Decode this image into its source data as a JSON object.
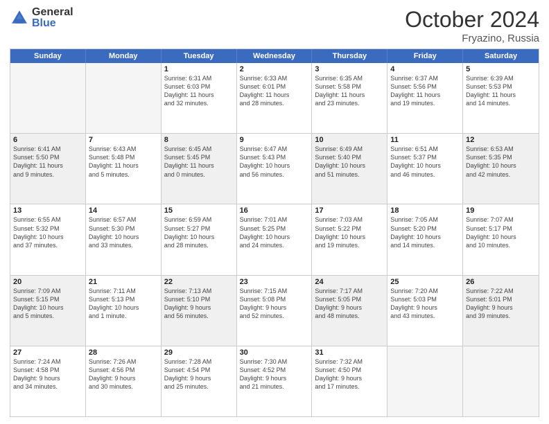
{
  "logo": {
    "general": "General",
    "blue": "Blue"
  },
  "title": {
    "month": "October 2024",
    "location": "Fryazino, Russia"
  },
  "header": {
    "days": [
      "Sunday",
      "Monday",
      "Tuesday",
      "Wednesday",
      "Thursday",
      "Friday",
      "Saturday"
    ]
  },
  "rows": [
    [
      {
        "day": "",
        "info": "",
        "empty": true
      },
      {
        "day": "",
        "info": "",
        "empty": true
      },
      {
        "day": "1",
        "info": "Sunrise: 6:31 AM\nSunset: 6:03 PM\nDaylight: 11 hours\nand 32 minutes."
      },
      {
        "day": "2",
        "info": "Sunrise: 6:33 AM\nSunset: 6:01 PM\nDaylight: 11 hours\nand 28 minutes."
      },
      {
        "day": "3",
        "info": "Sunrise: 6:35 AM\nSunset: 5:58 PM\nDaylight: 11 hours\nand 23 minutes."
      },
      {
        "day": "4",
        "info": "Sunrise: 6:37 AM\nSunset: 5:56 PM\nDaylight: 11 hours\nand 19 minutes."
      },
      {
        "day": "5",
        "info": "Sunrise: 6:39 AM\nSunset: 5:53 PM\nDaylight: 11 hours\nand 14 minutes."
      }
    ],
    [
      {
        "day": "6",
        "info": "Sunrise: 6:41 AM\nSunset: 5:50 PM\nDaylight: 11 hours\nand 9 minutes.",
        "shaded": true
      },
      {
        "day": "7",
        "info": "Sunrise: 6:43 AM\nSunset: 5:48 PM\nDaylight: 11 hours\nand 5 minutes."
      },
      {
        "day": "8",
        "info": "Sunrise: 6:45 AM\nSunset: 5:45 PM\nDaylight: 11 hours\nand 0 minutes.",
        "shaded": true
      },
      {
        "day": "9",
        "info": "Sunrise: 6:47 AM\nSunset: 5:43 PM\nDaylight: 10 hours\nand 56 minutes."
      },
      {
        "day": "10",
        "info": "Sunrise: 6:49 AM\nSunset: 5:40 PM\nDaylight: 10 hours\nand 51 minutes.",
        "shaded": true
      },
      {
        "day": "11",
        "info": "Sunrise: 6:51 AM\nSunset: 5:37 PM\nDaylight: 10 hours\nand 46 minutes."
      },
      {
        "day": "12",
        "info": "Sunrise: 6:53 AM\nSunset: 5:35 PM\nDaylight: 10 hours\nand 42 minutes.",
        "shaded": true
      }
    ],
    [
      {
        "day": "13",
        "info": "Sunrise: 6:55 AM\nSunset: 5:32 PM\nDaylight: 10 hours\nand 37 minutes."
      },
      {
        "day": "14",
        "info": "Sunrise: 6:57 AM\nSunset: 5:30 PM\nDaylight: 10 hours\nand 33 minutes.",
        "shaded": false
      },
      {
        "day": "15",
        "info": "Sunrise: 6:59 AM\nSunset: 5:27 PM\nDaylight: 10 hours\nand 28 minutes."
      },
      {
        "day": "16",
        "info": "Sunrise: 7:01 AM\nSunset: 5:25 PM\nDaylight: 10 hours\nand 24 minutes.",
        "shaded": false
      },
      {
        "day": "17",
        "info": "Sunrise: 7:03 AM\nSunset: 5:22 PM\nDaylight: 10 hours\nand 19 minutes."
      },
      {
        "day": "18",
        "info": "Sunrise: 7:05 AM\nSunset: 5:20 PM\nDaylight: 10 hours\nand 14 minutes.",
        "shaded": false
      },
      {
        "day": "19",
        "info": "Sunrise: 7:07 AM\nSunset: 5:17 PM\nDaylight: 10 hours\nand 10 minutes."
      }
    ],
    [
      {
        "day": "20",
        "info": "Sunrise: 7:09 AM\nSunset: 5:15 PM\nDaylight: 10 hours\nand 5 minutes.",
        "shaded": true
      },
      {
        "day": "21",
        "info": "Sunrise: 7:11 AM\nSunset: 5:13 PM\nDaylight: 10 hours\nand 1 minute."
      },
      {
        "day": "22",
        "info": "Sunrise: 7:13 AM\nSunset: 5:10 PM\nDaylight: 9 hours\nand 56 minutes.",
        "shaded": true
      },
      {
        "day": "23",
        "info": "Sunrise: 7:15 AM\nSunset: 5:08 PM\nDaylight: 9 hours\nand 52 minutes."
      },
      {
        "day": "24",
        "info": "Sunrise: 7:17 AM\nSunset: 5:05 PM\nDaylight: 9 hours\nand 48 minutes.",
        "shaded": true
      },
      {
        "day": "25",
        "info": "Sunrise: 7:20 AM\nSunset: 5:03 PM\nDaylight: 9 hours\nand 43 minutes."
      },
      {
        "day": "26",
        "info": "Sunrise: 7:22 AM\nSunset: 5:01 PM\nDaylight: 9 hours\nand 39 minutes.",
        "shaded": true
      }
    ],
    [
      {
        "day": "27",
        "info": "Sunrise: 7:24 AM\nSunset: 4:58 PM\nDaylight: 9 hours\nand 34 minutes."
      },
      {
        "day": "28",
        "info": "Sunrise: 7:26 AM\nSunset: 4:56 PM\nDaylight: 9 hours\nand 30 minutes.",
        "shaded": false
      },
      {
        "day": "29",
        "info": "Sunrise: 7:28 AM\nSunset: 4:54 PM\nDaylight: 9 hours\nand 25 minutes."
      },
      {
        "day": "30",
        "info": "Sunrise: 7:30 AM\nSunset: 4:52 PM\nDaylight: 9 hours\nand 21 minutes.",
        "shaded": false
      },
      {
        "day": "31",
        "info": "Sunrise: 7:32 AM\nSunset: 4:50 PM\nDaylight: 9 hours\nand 17 minutes."
      },
      {
        "day": "",
        "info": "",
        "empty": true
      },
      {
        "day": "",
        "info": "",
        "empty": true
      }
    ]
  ]
}
